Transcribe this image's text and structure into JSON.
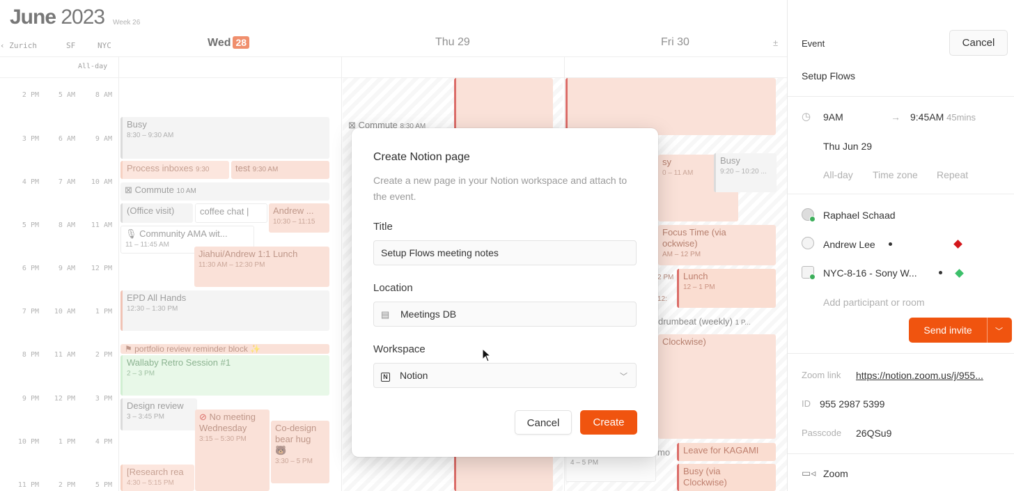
{
  "header": {
    "month": "June",
    "year": "2023",
    "week": "Week 26",
    "timezones": [
      "Zurich",
      "SF",
      "NYC"
    ],
    "allday": "All-day",
    "days": {
      "wed_label": "Wed",
      "wed_num": "28",
      "thu": "Thu 29",
      "fri": "Fri 30"
    },
    "plusminus": "±"
  },
  "times": {
    "zurich": [
      "2 PM",
      "3 PM",
      "4 PM",
      "5 PM",
      "6 PM",
      "7 PM",
      "8 PM",
      "9 PM",
      "10 PM",
      "11 PM"
    ],
    "sf": [
      "5 AM",
      "6 AM",
      "7 AM",
      "8 AM",
      "9 AM",
      "10 AM",
      "11 AM",
      "12 PM",
      "1 PM",
      "2 PM"
    ],
    "nyc": [
      "8 AM",
      "9 AM",
      "10 AM",
      "11 AM",
      "12 PM",
      "1 PM",
      "2 PM",
      "3 PM",
      "4 PM",
      "5 PM"
    ]
  },
  "events": {
    "busy_title": "Busy",
    "busy_time": "8:30 – 9:30 AM",
    "process_inboxes": "Process inboxes",
    "process_inboxes_time": "9:30",
    "test": "test",
    "test_time": "9:30 AM",
    "commute_wed": "Commute",
    "commute_wed_time": "10 AM",
    "office_visit": "(Office visit)",
    "coffee_chat": "coffee chat |",
    "andrew": "Andrew ...",
    "andrew_time": "10:30 – 11:15",
    "community_ama": "Community AMA wit...",
    "community_ama_time": "11 – 11:45 AM",
    "jiahui_lunch": "Jiahui/Andrew 1:1 Lunch",
    "jiahui_lunch_time": "11:30 AM – 12:30 PM",
    "epd": "EPD All Hands",
    "epd_time": "12:30 – 1:30 PM",
    "portfolio": "portfolio review reminder block",
    "wallaby": "Wallaby Retro Session #1",
    "wallaby_time": "2 – 3 PM",
    "design_review": "Design review",
    "design_review_time": "3 – 3:45 PM",
    "no_meeting": "No meeting Wednesday",
    "no_meeting_time": "3:15 – 5:30 PM",
    "codesign": "Co-design bear hug",
    "codesign_time": "3:30 – 5 PM",
    "research": "[Research rea",
    "research_time": "4:30 – 5:15 PM",
    "commute_thu": "Commute",
    "commute_thu_time": "8:30 AM",
    "busy_fri": "Busy",
    "busy_fri_time": "9:20 – 10:20 ...",
    "fri_sy": "sy",
    "fri_sy_time": "0 – 11 AM",
    "focus_time": "Focus Time (via",
    "focus_time2": "ockwise)",
    "focus_time_time": "AM – 12 PM",
    "lunch": "Lunch",
    "lunch_time": "12 – 1 PM",
    "fri_2pm": "2 PM",
    "fri_12": "12:",
    "drumbeat": "drumbeat (weekly)",
    "drumbeat_time": "1 P...",
    "clockwise": "Clockwise)",
    "leave_kagami": "Leave for KAGAMI",
    "fri_mo": "mo",
    "fri_4pm": "4 – 5 PM",
    "busy_via": "Busy (via",
    "busy_via2": "Clockwise)"
  },
  "modal": {
    "title": "Create Notion page",
    "description": "Create a new page in your Notion workspace and attach to the event.",
    "title_label": "Title",
    "title_value": "Setup Flows meeting notes",
    "location_label": "Location",
    "location_value": "Meetings DB",
    "workspace_label": "Workspace",
    "workspace_value": "Notion",
    "cancel": "Cancel",
    "create": "Create"
  },
  "panel": {
    "heading": "Event",
    "cancel": "Cancel",
    "event_name": "Setup Flows",
    "start": "9AM",
    "arrow": "→",
    "end": "9:45AM",
    "duration": "45mins",
    "date": "Thu Jun 29",
    "allday": "All-day",
    "timezone": "Time zone",
    "repeat": "Repeat",
    "participants": [
      "Raphael Schaad",
      "Andrew Lee",
      "NYC-8-16 - Sony W..."
    ],
    "add_participant": "Add participant or room",
    "send_invite": "Send invite",
    "zoom_link_label": "Zoom link",
    "zoom_link": "https://notion.zoom.us/j/955...",
    "id_label": "ID",
    "id_value": "955 2987 5399",
    "passcode_label": "Passcode",
    "passcode_value": "26QSu9",
    "conferencing": "Zoom"
  },
  "colors": {
    "accent": "#f0540f",
    "today_badge": "#e9541f",
    "event_red": "#c8201a",
    "accepted_green": "#3cae5a",
    "diamond_red": "#d3161b",
    "diamond_green": "#3cc06a"
  }
}
